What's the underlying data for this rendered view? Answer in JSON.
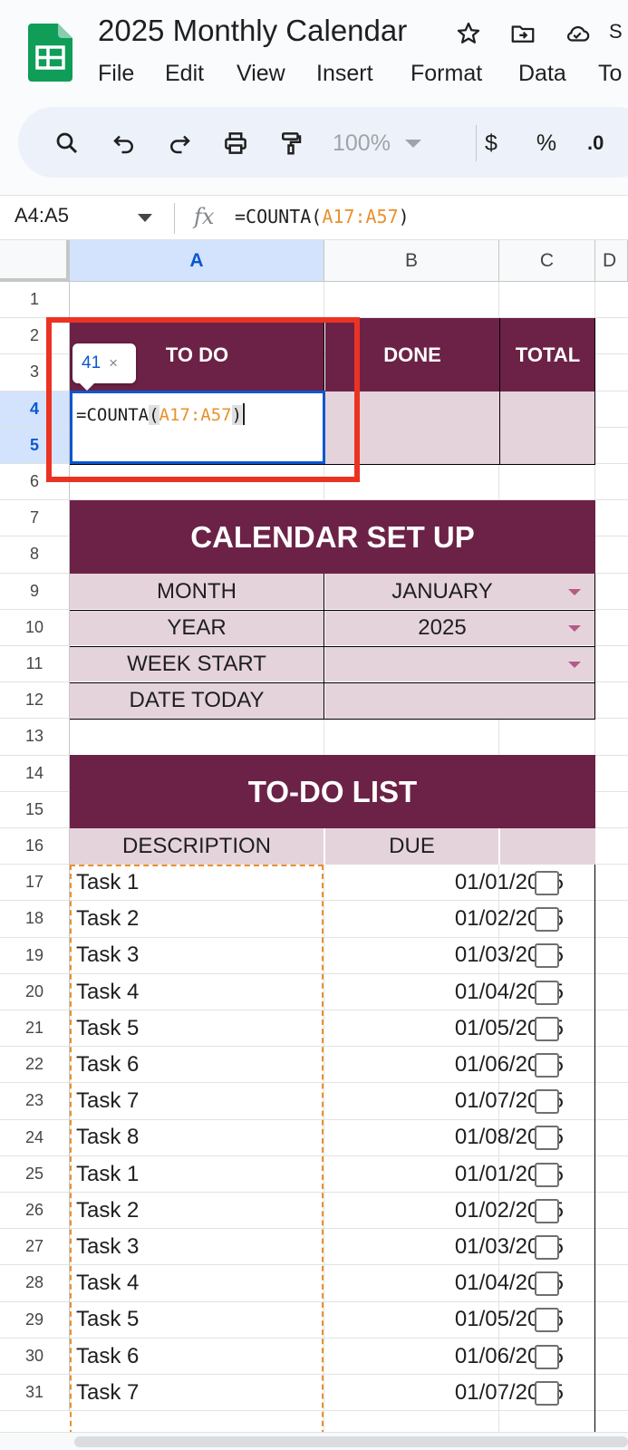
{
  "app": {
    "doc_title": "2025 Monthly Calendar",
    "header_icons": [
      "star-icon",
      "move-folder-icon",
      "cloud-status-icon"
    ],
    "header_cut_text": "S"
  },
  "menu": [
    "File",
    "Edit",
    "View",
    "Insert",
    "Format",
    "Data",
    "To"
  ],
  "toolbar": {
    "tools": [
      "search-icon",
      "undo-icon",
      "redo-icon",
      "print-icon",
      "paint-format-icon"
    ],
    "zoom": "100%",
    "currency": "$",
    "percent": "%",
    "decimal": ".0"
  },
  "formula_bar": {
    "name_box": "A4:A5",
    "fx": "fx",
    "formula_prefix": "=COUNTA(",
    "formula_ref": "A17:A57",
    "formula_suffix": ")"
  },
  "columns": [
    "A",
    "B",
    "C",
    "D"
  ],
  "rows": [
    "1",
    "2",
    "3",
    "4",
    "5",
    "6",
    "7",
    "8",
    "9",
    "10",
    "11",
    "12",
    "13",
    "14",
    "15",
    "16",
    "17",
    "18",
    "19",
    "20",
    "21",
    "22",
    "23",
    "24",
    "25",
    "26",
    "27",
    "28",
    "29",
    "30",
    "31"
  ],
  "summary": {
    "todo": "TO DO",
    "done": "DONE",
    "total": "TOTAL"
  },
  "editing": {
    "count_hint": "41",
    "close": "×",
    "func": "=COUNTA",
    "open": "(",
    "ref": "A17:A57",
    "close_paren": ")"
  },
  "setup": {
    "title": "CALENDAR SET UP",
    "month_label": "MONTH",
    "month_value": "JANUARY",
    "year_label": "YEAR",
    "year_value": "2025",
    "week_label": "WEEK START",
    "week_value": "",
    "date_label": "DATE TODAY",
    "date_value": ""
  },
  "todo_list": {
    "title": "TO-DO LIST",
    "col_description": "DESCRIPTION",
    "col_due": "DUE",
    "tasks": [
      {
        "desc": "Task 1",
        "due": "01/01/2025",
        "done": false
      },
      {
        "desc": "Task 2",
        "due": "01/02/2025",
        "done": false
      },
      {
        "desc": "Task 3",
        "due": "01/03/2025",
        "done": false
      },
      {
        "desc": "Task 4",
        "due": "01/04/2025",
        "done": false
      },
      {
        "desc": "Task 5",
        "due": "01/05/2025",
        "done": false
      },
      {
        "desc": "Task 6",
        "due": "01/06/2025",
        "done": false
      },
      {
        "desc": "Task 7",
        "due": "01/07/2025",
        "done": false
      },
      {
        "desc": "Task 8",
        "due": "01/08/2025",
        "done": false
      },
      {
        "desc": "Task 1",
        "due": "01/01/2025",
        "done": false
      },
      {
        "desc": "Task 2",
        "due": "01/02/2025",
        "done": false
      },
      {
        "desc": "Task 3",
        "due": "01/03/2025",
        "done": false
      },
      {
        "desc": "Task 4",
        "due": "01/04/2025",
        "done": false
      },
      {
        "desc": "Task 5",
        "due": "01/05/2025",
        "done": false
      },
      {
        "desc": "Task 6",
        "due": "01/06/2025",
        "done": false
      },
      {
        "desc": "Task 7",
        "due": "01/07/2025",
        "done": false
      }
    ]
  },
  "colors": {
    "band": "#6c2246",
    "pink_fill": "#e5d3dc",
    "selection_blue": "#0b57d0",
    "reference_orange": "#e8912d",
    "highlight_red": "#ea3323"
  }
}
